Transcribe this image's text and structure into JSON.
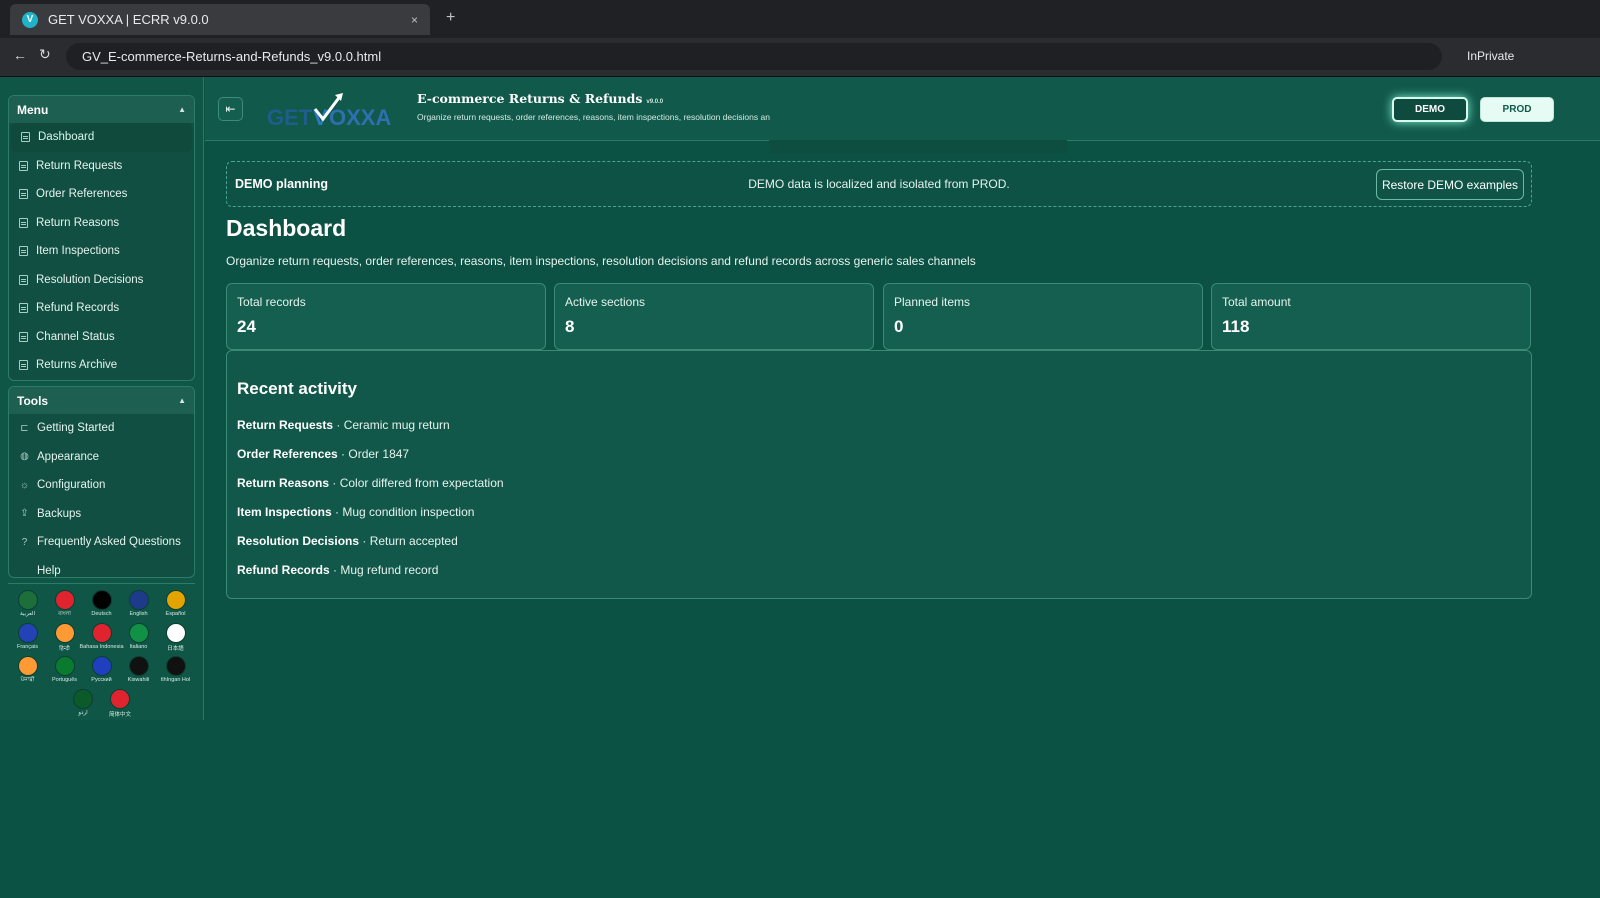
{
  "browser": {
    "tab_title": "GET VOXXA | ECRR v9.0.0",
    "favicon": "V",
    "tab_close": "×",
    "new_tab": "+",
    "back": "←",
    "reload": "↻",
    "url": "GV_E-commerce-Returns-and-Refunds_v9.0.0.html",
    "inprivate": "InPrivate"
  },
  "sidebar": {
    "menu_title": "Menu",
    "menu_items": [
      {
        "label": "Dashboard",
        "active": true
      },
      {
        "label": "Return Requests"
      },
      {
        "label": "Order References"
      },
      {
        "label": "Return Reasons"
      },
      {
        "label": "Item Inspections"
      },
      {
        "label": "Resolution Decisions"
      },
      {
        "label": "Refund Records"
      },
      {
        "label": "Channel Status"
      },
      {
        "label": "Returns Archive"
      }
    ],
    "tools_title": "Tools",
    "tools_items": [
      {
        "label": "Getting Started",
        "icon": "rocket-icon"
      },
      {
        "label": "Appearance",
        "icon": "palette-icon"
      },
      {
        "label": "Configuration",
        "icon": "gear-icon"
      },
      {
        "label": "Backups",
        "icon": "upload-icon"
      },
      {
        "label": "Frequently Asked Questions",
        "icon": "question-icon"
      },
      {
        "label": "Help",
        "icon": "none"
      }
    ],
    "languages": [
      {
        "label": "العربية",
        "color": "#1d6e3a"
      },
      {
        "label": "বাংলা",
        "color": "#e0242f"
      },
      {
        "label": "Deutsch",
        "color": "#000000"
      },
      {
        "label": "English",
        "color": "#1e3a8a"
      },
      {
        "label": "Español",
        "color": "#e3a300"
      },
      {
        "label": "Français",
        "color": "#2342b5"
      },
      {
        "label": "हिन्दी",
        "color": "#ff9933"
      },
      {
        "label": "Bahasa Indonesia",
        "color": "#e0242f"
      },
      {
        "label": "Italiano",
        "color": "#119146"
      },
      {
        "label": "日本語",
        "color": "#ffffff"
      },
      {
        "label": "ਪੰਜਾਬੀ",
        "color": "#ff9933"
      },
      {
        "label": "Português",
        "color": "#0a7a2f"
      },
      {
        "label": "Русский",
        "color": "#1f3fbf"
      },
      {
        "label": "Kiswahili",
        "color": "#111111"
      },
      {
        "label": "tlhIngan Hol",
        "color": "#111111"
      },
      {
        "label": "اردو",
        "color": "#0c5a2a"
      },
      {
        "label": "简体中文",
        "color": "#e0242f"
      }
    ]
  },
  "header": {
    "logo_text": "GETVOXXA",
    "app_title": "E-commerce Returns & Refunds",
    "version": "v9.0.0",
    "subtitle": "Organize return requests, order references, reasons, item inspections, resolution decisions an",
    "demo_label": "DEMO",
    "prod_label": "PROD"
  },
  "banner": {
    "label": "DEMO planning",
    "message": "DEMO data is localized and isolated from PROD.",
    "restore": "Restore DEMO examples"
  },
  "page": {
    "title": "Dashboard",
    "subtitle": "Organize return requests, order references, reasons, item inspections, resolution decisions and refund records across generic sales channels"
  },
  "stats": [
    {
      "label": "Total records",
      "value": "24"
    },
    {
      "label": "Active sections",
      "value": "8"
    },
    {
      "label": "Planned items",
      "value": "0"
    },
    {
      "label": "Total amount",
      "value": "118"
    }
  ],
  "activity": {
    "title": "Recent activity",
    "items": [
      {
        "section": "Return Requests",
        "text": " · Ceramic mug return"
      },
      {
        "section": "Order References",
        "text": " · Order 1847"
      },
      {
        "section": "Return Reasons",
        "text": " · Color differed from expectation"
      },
      {
        "section": "Item Inspections",
        "text": " · Mug condition inspection"
      },
      {
        "section": "Resolution Decisions",
        "text": " · Return accepted"
      },
      {
        "section": "Refund Records",
        "text": " · Mug refund record"
      }
    ]
  }
}
